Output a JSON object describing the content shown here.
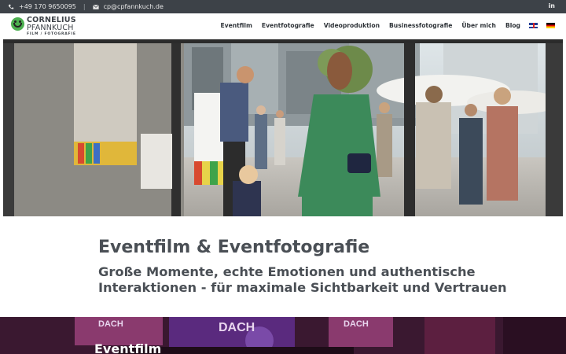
{
  "topbar": {
    "phone": "+49 170 9650095",
    "separator": "|",
    "email": "cp@cpfannkuch.de",
    "social": "in"
  },
  "logo": {
    "line1": "CORNELIUS",
    "line2": "PFANNKUCH",
    "line3": "FILM / FOTOGRAFIE"
  },
  "nav": {
    "items": [
      "Eventfilm",
      "Eventfotografie",
      "Videoproduktion",
      "Businessfotografie",
      "Über mich",
      "Blog"
    ],
    "languages": [
      "English",
      "Deutsch"
    ]
  },
  "hero": {
    "banner_texts": [
      "DACH",
      "DACH",
      "DACH"
    ]
  },
  "main": {
    "title": "Eventfilm & Eventfotografie",
    "subtitle_line1": "Große Momente, echte Emotionen und authentische",
    "subtitle_line2": "Interaktionen - für maximale Sichtbarkeit und Vertrauen"
  },
  "section": {
    "title": "Eventfilm"
  },
  "colors": {
    "topbar_bg": "#3d4248",
    "text_dark": "#4a4f55",
    "logo_green": "#4caf50",
    "band_bg": "#3a1830"
  }
}
